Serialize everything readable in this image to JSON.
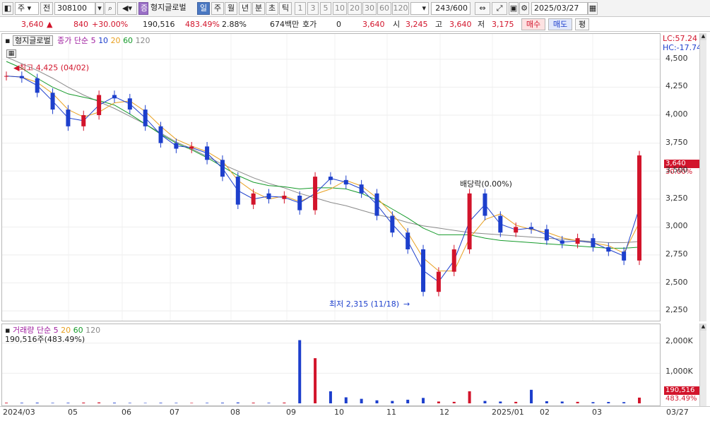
{
  "toolbar": {
    "market": "주",
    "prev_label": "전",
    "stock_code": "308100",
    "stock_name": "형지글로벌",
    "stock_tag": "증",
    "periods": [
      "일",
      "주",
      "월",
      "년",
      "분",
      "초",
      "틱"
    ],
    "active_period": "일",
    "intervals": [
      "1",
      "3",
      "5",
      "10",
      "20",
      "30",
      "60",
      "120"
    ],
    "count": "243/600",
    "date": "2025/03/27"
  },
  "quote": {
    "price": "3,640",
    "change": "840",
    "change_pct": "+30.00%",
    "volume": "190,516",
    "volume_pct": "483.49%",
    "turnover_rate": "2.88%",
    "trade_value": "674백만",
    "hoga_label": "호가",
    "hoga_value": "0",
    "hoga_price": "3,640",
    "open_label": "시",
    "open": "3,245",
    "high_label": "고",
    "high": "3,640",
    "low_label": "저",
    "low": "3,175",
    "buy_label": "매수",
    "sell_label": "매도",
    "avg_label": "평"
  },
  "price_panel": {
    "name_label": "형지글로벌",
    "legend_title": "종가 단순",
    "ma_periods": [
      "5",
      "10",
      "20",
      "60",
      "120"
    ],
    "lc": "LC:57.24",
    "hc": "HC:-17.74",
    "high_annotation": "최고 4,425 (04/02)",
    "low_annotation": "최저 2,315 (11/18)",
    "dividend_annotation": "배당락(0.00%)",
    "last_price_label": "3,640",
    "last_pct_label": "30.00%",
    "y_ticks": [
      "4,500",
      "4,250",
      "4,000",
      "3,750",
      "3,500",
      "3,250",
      "3,000",
      "2,750",
      "2,500",
      "2,250"
    ]
  },
  "volume_panel": {
    "legend_title": "거래량 단순",
    "ma_periods": [
      "5",
      "20",
      "60",
      "120"
    ],
    "value_label": "190,516주(483.49%)",
    "last_volume_label": "190,516",
    "last_volume_pct": "483.49%",
    "y_ticks": [
      "2,000K",
      "1,000K"
    ]
  },
  "x_axis": [
    "2024/03",
    "05",
    "06",
    "07",
    "08",
    "09",
    "10",
    "11",
    "12",
    "2025/01",
    "02",
    "03",
    "03/27"
  ],
  "colors": {
    "up": "#d2142b",
    "down": "#1d3fcc",
    "ma5": "#a020a0",
    "ma10": "#1d3fcc",
    "ma20": "#e8a020",
    "ma60": "#159a2a",
    "ma120": "#8a8a8a"
  },
  "chart_data": {
    "type": "candlestick",
    "title": "",
    "ylim": [
      2200,
      4600
    ],
    "x": [
      "2024/03",
      "05",
      "06",
      "07",
      "08",
      "09",
      "10",
      "11",
      "12",
      "2025/01",
      "02",
      "03",
      "03/27"
    ],
    "close_series": [
      4350,
      4330,
      4200,
      4050,
      3900,
      4000,
      4180,
      4150,
      4050,
      3900,
      3750,
      3700,
      3720,
      3600,
      3450,
      3200,
      3300,
      3250,
      3280,
      3150,
      3450,
      3420,
      3380,
      3300,
      3100,
      2950,
      2800,
      2420,
      2600,
      2800,
      3300,
      3100,
      2950,
      3000,
      2980,
      2880,
      2850,
      2900,
      2820,
      2780,
      2700,
      3640
    ],
    "ma120": [
      4520,
      4460,
      4400,
      4330,
      4250,
      4180,
      4120,
      4060,
      3990,
      3920,
      3840,
      3760,
      3700,
      3630,
      3560,
      3500,
      3440,
      3390,
      3350,
      3300,
      3260,
      3220,
      3190,
      3150,
      3110,
      3080,
      3040,
      3010,
      2990,
      2970,
      2950,
      2940,
      2930,
      2920,
      2910,
      2900,
      2890,
      2880,
      2870,
      2860,
      2860,
      2870
    ],
    "ma60": [
      4480,
      4420,
      4330,
      4250,
      4190,
      4160,
      4130,
      4090,
      4010,
      3920,
      3830,
      3750,
      3690,
      3620,
      3540,
      3460,
      3400,
      3370,
      3360,
      3340,
      3350,
      3350,
      3340,
      3300,
      3240,
      3160,
      3080,
      2990,
      2930,
      2930,
      2930,
      2900,
      2880,
      2870,
      2860,
      2850,
      2840,
      2830,
      2820,
      2810,
      2810,
      2820
    ],
    "volume": [
      20,
      18,
      22,
      15,
      18,
      25,
      30,
      20,
      15,
      12,
      18,
      15,
      14,
      16,
      20,
      28,
      22,
      18,
      25,
      2100,
      1500,
      400,
      200,
      150,
      100,
      80,
      120,
      180,
      60,
      50,
      400,
      80,
      60,
      50,
      450,
      70,
      60,
      50,
      40,
      45,
      40,
      190
    ],
    "y_ticks": [
      "4,500",
      "4,250",
      "4,000",
      "3,750",
      "3,500",
      "3,250",
      "3,000",
      "2,750",
      "2,500",
      "2,250"
    ],
    "annotations": [
      "최고 4,425 (04/02)",
      "최저 2,315 (11/18)",
      "배당락(0.00%)"
    ]
  }
}
